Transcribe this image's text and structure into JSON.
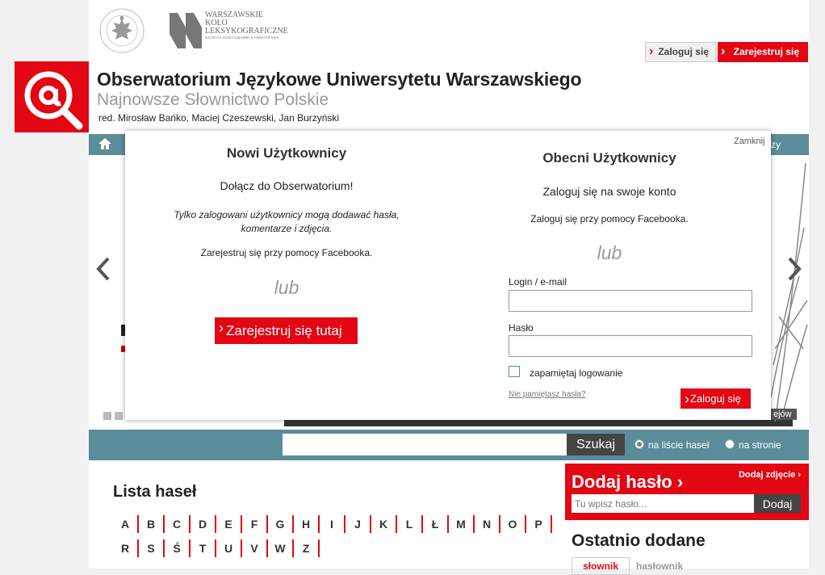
{
  "top": {
    "logo_wkl_lines": [
      "WARSZAWSKIE",
      "KOŁO",
      "LEKSYKOGRAFICZNE"
    ],
    "logo_wkl_sub": "SOCIETAS LEXICOGRAPHICA VARSOVIENSIS",
    "login_label": "Zaloguj się",
    "register_label": "Zarejestruj się"
  },
  "header": {
    "title": "Obserwatorium Językowe Uniwersytetu Warszawskiego",
    "subtitle": "Najnowsze Słownictwo Polskie",
    "editors": "red. Mirosław Bańko, Maciej Czeszewski, Jan Burzyński"
  },
  "nav": {
    "fragment": "zy"
  },
  "banner": {
    "more_label": "ejów"
  },
  "search": {
    "placeholder": "",
    "button": "Szukaj",
    "opt1": "na liście haseł",
    "opt2": "na stronie"
  },
  "lista": {
    "title": "Lista haseł",
    "letters": [
      "A",
      "B",
      "C",
      "D",
      "E",
      "F",
      "G",
      "H",
      "I",
      "J",
      "K",
      "L",
      "Ł",
      "M",
      "N",
      "O",
      "P",
      "R",
      "S",
      "Ś",
      "T",
      "U",
      "V",
      "W",
      "Z"
    ]
  },
  "dodaj": {
    "title": "Dodaj hasło",
    "photo": "Dodaj zdjęcie",
    "placeholder": "Tu wpisz hasło...",
    "button": "Dodaj"
  },
  "ostatnio": {
    "title": "Ostatnio dodane",
    "tab1": "słownik",
    "tab2": "hasłownik"
  },
  "modal": {
    "close": "Zamknij",
    "new_users": {
      "title": "Nowi Użytkownicy",
      "join": "Dołącz do Obserwatorium!",
      "only": "Tylko zalogowani użytkownicy mogą dodawać hasła, komentarze i zdjęcia.",
      "facebook": "Zarejestruj się przy pomocy Facebooka.",
      "or": "lub",
      "button": "Zarejestruj się tutaj"
    },
    "existing_users": {
      "title": "Obecni Użytkownicy",
      "subtitle": "Zaloguj się na swoje konto",
      "facebook": "Zaloguj się przy pomocy Facebooka.",
      "or": "lub",
      "login_label": "Login / e-mail",
      "password_label": "Hasło",
      "remember": "zapamiętaj logowanie",
      "forgot": "Nie pamiętasz hasła?",
      "button": "Zaloguj się"
    }
  }
}
